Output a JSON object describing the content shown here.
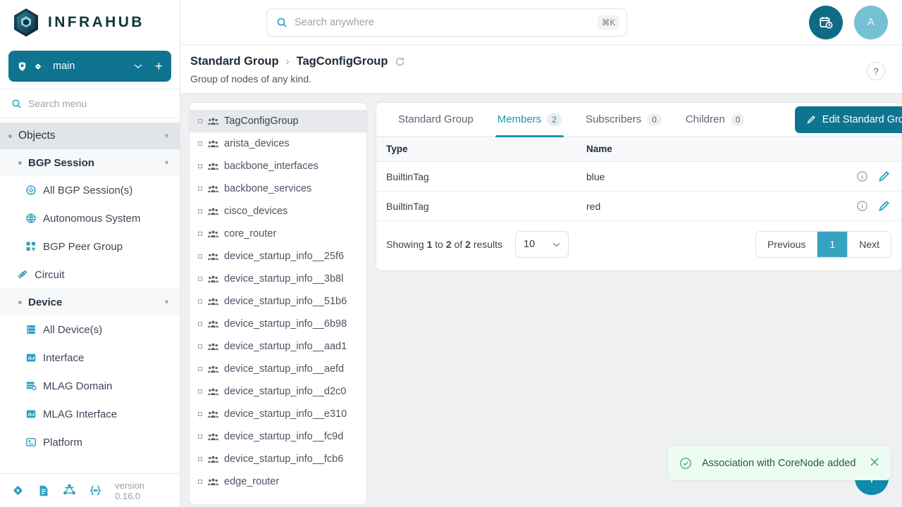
{
  "brand": {
    "name": "INFRAHUB",
    "logo_icon": "infrahub-cube-logo"
  },
  "branch": {
    "label": "main",
    "chevron_icon": "chevron-down-icon",
    "add_icon": "plus-icon",
    "shield_icon": "shield-check-icon",
    "branch_icon": "git-branch-icon",
    "color": "#0e7490"
  },
  "menu_search": {
    "placeholder": "Search menu",
    "value": "",
    "icon": "search-icon"
  },
  "sidebar": {
    "items": [
      {
        "label": "Objects",
        "level": 0,
        "type": "group",
        "expanded": true,
        "icon": "bullet-dot"
      },
      {
        "label": "BGP Session",
        "level": 1,
        "type": "group",
        "expanded": true,
        "icon": "bullet-dot"
      },
      {
        "label": "All BGP Session(s)",
        "level": 2,
        "type": "leaf",
        "icon": "bgp-session-icon"
      },
      {
        "label": "Autonomous System",
        "level": 2,
        "type": "leaf",
        "icon": "autonomous-system-icon"
      },
      {
        "label": "BGP Peer Group",
        "level": 2,
        "type": "leaf",
        "icon": "peer-group-icon"
      },
      {
        "label": "Circuit",
        "level": 1,
        "type": "leaf",
        "icon": "circuit-icon"
      },
      {
        "label": "Device",
        "level": 1,
        "type": "group",
        "expanded": true,
        "icon": "bullet-dot"
      },
      {
        "label": "All Device(s)",
        "level": 2,
        "type": "leaf",
        "icon": "device-icon"
      },
      {
        "label": "Interface",
        "level": 2,
        "type": "leaf",
        "icon": "interface-icon"
      },
      {
        "label": "MLAG Domain",
        "level": 2,
        "type": "leaf",
        "icon": "mlag-domain-icon"
      },
      {
        "label": "MLAG Interface",
        "level": 2,
        "type": "leaf",
        "icon": "mlag-interface-icon"
      },
      {
        "label": "Platform",
        "level": 2,
        "type": "leaf",
        "icon": "platform-icon"
      }
    ],
    "footer": {
      "version": "version 0.16.0",
      "icons": [
        "git-branch-icon",
        "docs-icon",
        "graphql-icon",
        "json-braces-icon"
      ]
    }
  },
  "topbar": {
    "search": {
      "placeholder": "Search anywhere",
      "value": "",
      "icon": "search-icon",
      "shortcut": "⌘K"
    },
    "tasks_icon": "calendar-clock-icon",
    "avatar_initial": "A"
  },
  "page": {
    "breadcrumb": [
      "Standard Group",
      "TagConfigGroup"
    ],
    "separator": "›",
    "refresh_icon": "refresh-icon",
    "subtitle": "Group of nodes of any kind.",
    "help_label": "?"
  },
  "object_list": {
    "items": [
      {
        "label": "TagConfigGroup",
        "active": true
      },
      {
        "label": "arista_devices",
        "active": false
      },
      {
        "label": "backbone_interfaces",
        "active": false
      },
      {
        "label": "backbone_services",
        "active": false
      },
      {
        "label": "cisco_devices",
        "active": false
      },
      {
        "label": "core_router",
        "active": false
      },
      {
        "label": "device_startup_info__25f6",
        "active": false
      },
      {
        "label": "device_startup_info__3b8l",
        "active": false
      },
      {
        "label": "device_startup_info__51b6",
        "active": false
      },
      {
        "label": "device_startup_info__6b98",
        "active": false
      },
      {
        "label": "device_startup_info__aad1",
        "active": false
      },
      {
        "label": "device_startup_info__aefd",
        "active": false
      },
      {
        "label": "device_startup_info__d2c0",
        "active": false
      },
      {
        "label": "device_startup_info__e310",
        "active": false
      },
      {
        "label": "device_startup_info__fc9d",
        "active": false
      },
      {
        "label": "device_startup_info__fcb6",
        "active": false
      },
      {
        "label": "edge_router",
        "active": false
      }
    ],
    "row_icon": "group-users-icon",
    "bullet_icon": "square-bullet-icon"
  },
  "detail": {
    "tabs": [
      {
        "label": "Standard Group",
        "count": null,
        "active": false
      },
      {
        "label": "Members",
        "count": "2",
        "active": true
      },
      {
        "label": "Subscribers",
        "count": "0",
        "active": false
      },
      {
        "label": "Children",
        "count": "0",
        "active": false
      }
    ],
    "edit_button": {
      "label": "Edit Standard Group",
      "icon": "pencil-icon"
    },
    "table": {
      "columns": [
        "Type",
        "Name"
      ],
      "rows": [
        {
          "type": "BuiltinTag",
          "name": "blue",
          "info_icon": "info-icon",
          "edit_icon": "pencil-icon"
        },
        {
          "type": "BuiltinTag",
          "name": "red",
          "info_icon": "info-icon",
          "edit_icon": "pencil-icon"
        }
      ]
    },
    "pagination": {
      "showing_prefix": "Showing",
      "from": "1",
      "mid": "to",
      "to": "2",
      "of": "of",
      "total": "2",
      "suffix": "results",
      "per_page": "10",
      "per_page_chevron": "chevron-down-icon",
      "previous": "Previous",
      "current_page": "1",
      "next": "Next"
    }
  },
  "toast": {
    "message": "Association with CoreNode added",
    "status_icon": "check-circle-icon",
    "close_icon": "close-icon",
    "bg_color": "#eefbf3",
    "text_color": "#215c3c"
  },
  "fab": {
    "icon": "floating-action-icon",
    "color": "#0e8bab"
  }
}
